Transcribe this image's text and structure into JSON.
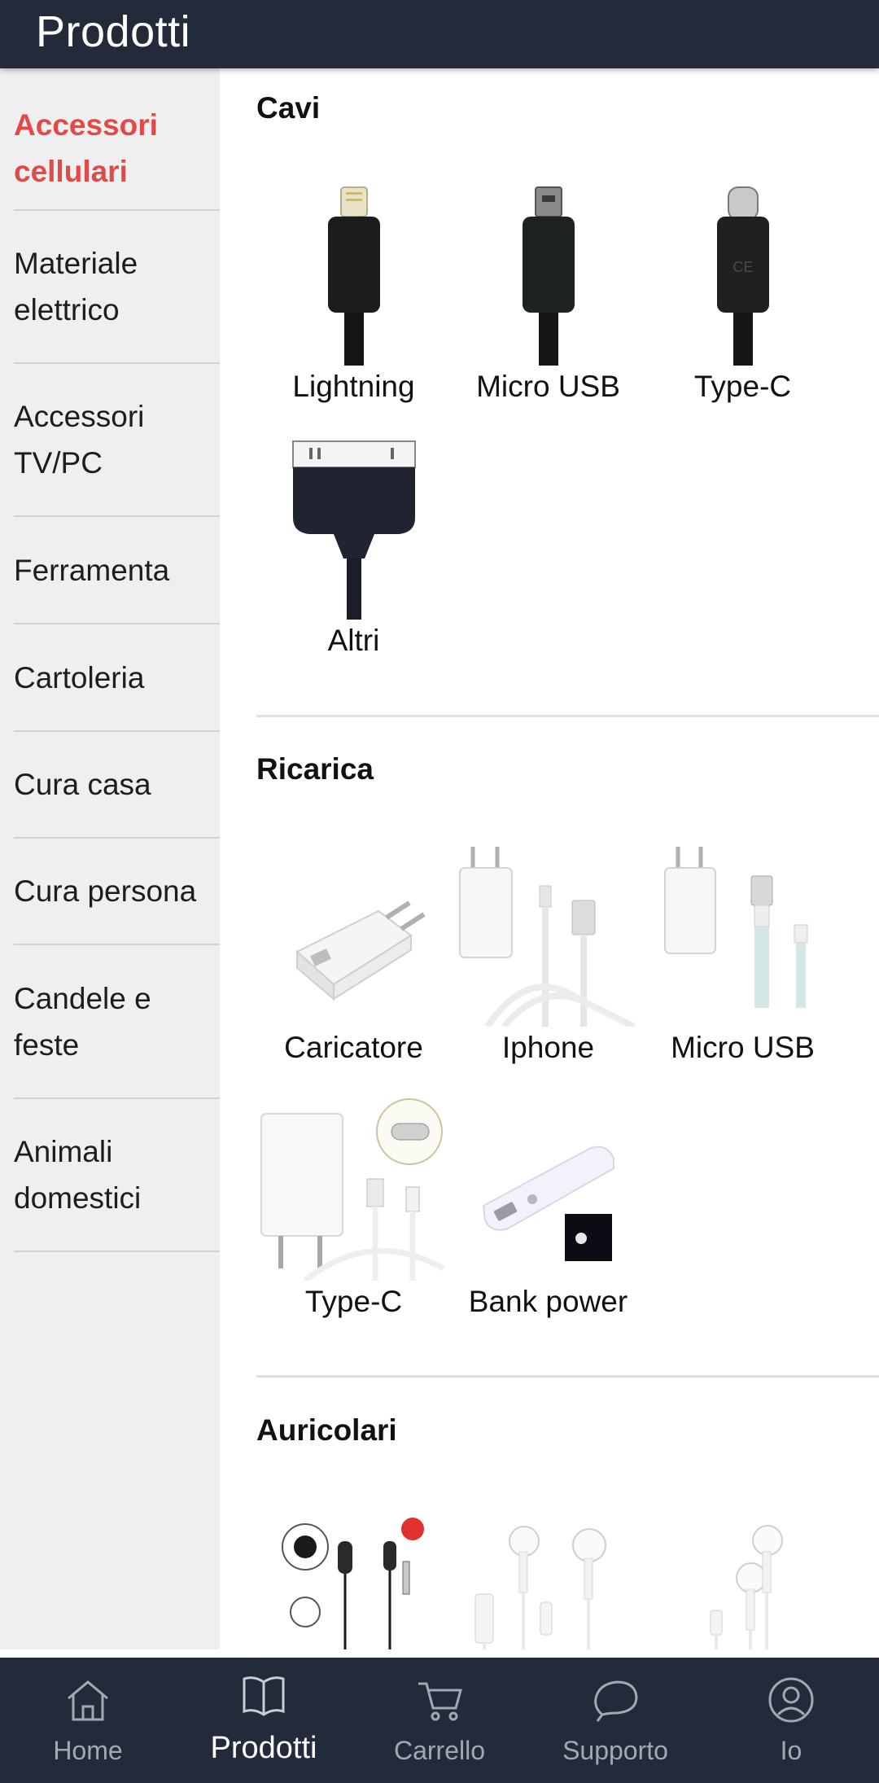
{
  "header": {
    "title": "Prodotti"
  },
  "sidebar": {
    "items": [
      {
        "label": "Accessori cellulari",
        "active": true
      },
      {
        "label": "Materiale elettrico",
        "active": false
      },
      {
        "label": "Accessori TV/PC",
        "active": false
      },
      {
        "label": "Ferramenta",
        "active": false
      },
      {
        "label": "Cartoleria",
        "active": false
      },
      {
        "label": "Cura casa",
        "active": false
      },
      {
        "label": "Cura persona",
        "active": false
      },
      {
        "label": "Candele e feste",
        "active": false
      },
      {
        "label": "Animali domestici",
        "active": false
      }
    ]
  },
  "sections": [
    {
      "title": "Cavi",
      "products": [
        {
          "label": "Lightning",
          "icon": "lightning-cable-icon"
        },
        {
          "label": "Micro USB",
          "icon": "micro-usb-cable-icon"
        },
        {
          "label": "Type-C",
          "icon": "type-c-cable-icon"
        },
        {
          "label": "Altri",
          "icon": "30-pin-cable-icon"
        }
      ]
    },
    {
      "title": "Ricarica",
      "products": [
        {
          "label": "Caricatore",
          "icon": "wall-charger-icon"
        },
        {
          "label": "Iphone",
          "icon": "iphone-charger-kit-icon"
        },
        {
          "label": "Micro USB",
          "icon": "micro-usb-charger-kit-icon"
        },
        {
          "label": "Type-C",
          "icon": "type-c-charger-kit-icon"
        },
        {
          "label": "Bank power",
          "icon": "power-bank-icon"
        }
      ]
    },
    {
      "title": "Auricolari",
      "products": [
        {
          "label": "",
          "icon": "in-ear-earphones-icon"
        },
        {
          "label": "",
          "icon": "type-c-earphones-icon"
        },
        {
          "label": "",
          "icon": "lightning-earphones-icon"
        }
      ]
    }
  ],
  "bottom_nav": {
    "items": [
      {
        "label": "Home",
        "icon": "home-icon",
        "active": false
      },
      {
        "label": "Prodotti",
        "icon": "book-icon",
        "active": true
      },
      {
        "label": "Carrello",
        "icon": "cart-icon",
        "active": false
      },
      {
        "label": "Supporto",
        "icon": "chat-bubble-icon",
        "active": false
      },
      {
        "label": "Io",
        "icon": "user-icon",
        "active": false
      }
    ]
  },
  "colors": {
    "header_bg": "#232b3b",
    "active_category": "#e24a4a",
    "sidebar_bg": "#efefef"
  }
}
